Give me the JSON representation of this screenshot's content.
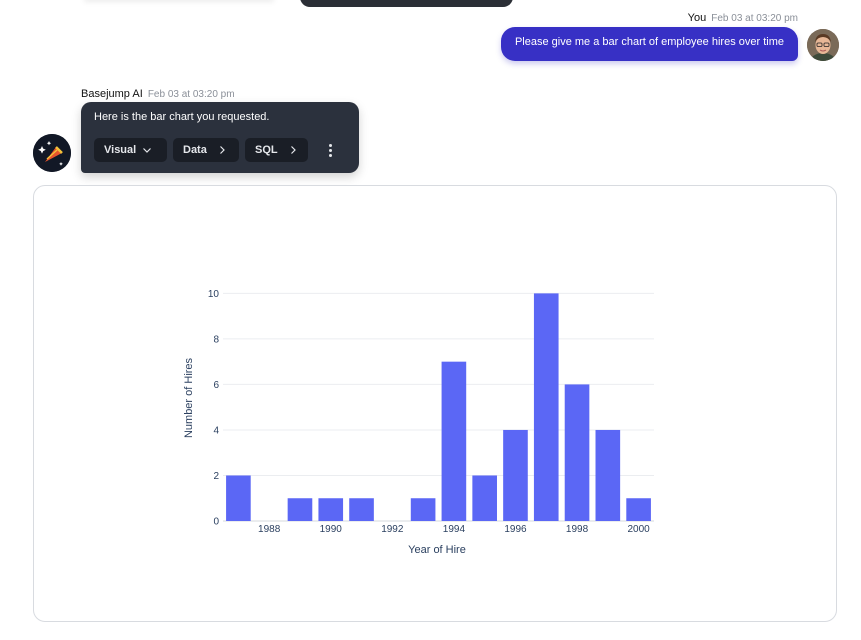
{
  "user_message": {
    "author": "You",
    "timestamp": "Feb 03 at 03:20 pm",
    "text": "Please give me a bar chart of employee hires over time",
    "bubble_color": "#3730c5"
  },
  "ai_message": {
    "author": "Basejump AI",
    "timestamp": "Feb 03 at 03:20 pm",
    "text": "Here is the bar chart you requested.",
    "actions": {
      "visual_label": "Visual",
      "data_label": "Data",
      "sql_label": "SQL",
      "more_icon": "kebab-menu-icon"
    },
    "bubble_color": "#2b313d"
  },
  "chart_data": {
    "type": "bar",
    "x": [
      1987,
      1989,
      1990,
      1991,
      1993,
      1994,
      1995,
      1996,
      1997,
      1998,
      1999,
      2000
    ],
    "values": [
      2,
      1,
      1,
      1,
      1,
      7,
      2,
      4,
      10,
      6,
      4,
      1
    ],
    "xlabel": "Year of Hire",
    "ylabel": "Number of Hires",
    "xlim": [
      1986.5,
      2000.5
    ],
    "ylim": [
      0,
      10.5
    ],
    "x_ticks": [
      "1988",
      "1990",
      "1992",
      "1994",
      "1996",
      "1998",
      "2000"
    ],
    "y_ticks": [
      "0",
      "2",
      "4",
      "6",
      "8",
      "10"
    ],
    "grid": true,
    "bar_color": "#5b67f5"
  }
}
